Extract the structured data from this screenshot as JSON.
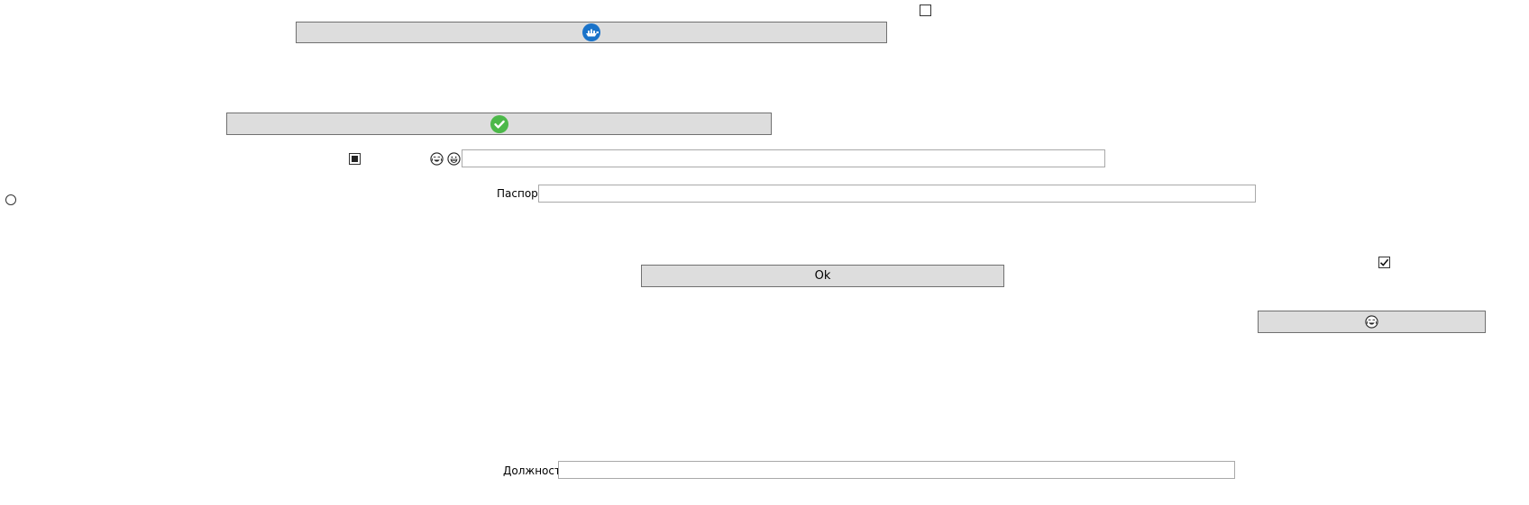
{
  "controls": {
    "top_checkbox": {
      "checked": false
    },
    "ship_button": {
      "icon": "ship-circle-icon",
      "icon_color": "#1a73c9"
    },
    "check_button": {
      "icon": "check-circle-icon",
      "icon_color": "#4cb849"
    },
    "indeterminate_checkbox": {
      "state": "indeterminate"
    },
    "emoji_icons": [
      "tears-of-joy-face-icon",
      "grinning-face-icon"
    ],
    "emoji_textbox": {
      "value": ""
    },
    "passport": {
      "label": "Паспорт",
      "value": ""
    },
    "radio": {
      "checked": false
    },
    "ok_button": {
      "label": "Ok"
    },
    "right_checkbox": {
      "checked": true
    },
    "emoji_button": {
      "icon": "tears-of-joy-face-icon"
    },
    "position": {
      "label": "Должность",
      "value": ""
    }
  },
  "colors": {
    "button_bg": "#dddddd",
    "button_border": "#707070",
    "textbox_border": "#a9a9a9"
  }
}
